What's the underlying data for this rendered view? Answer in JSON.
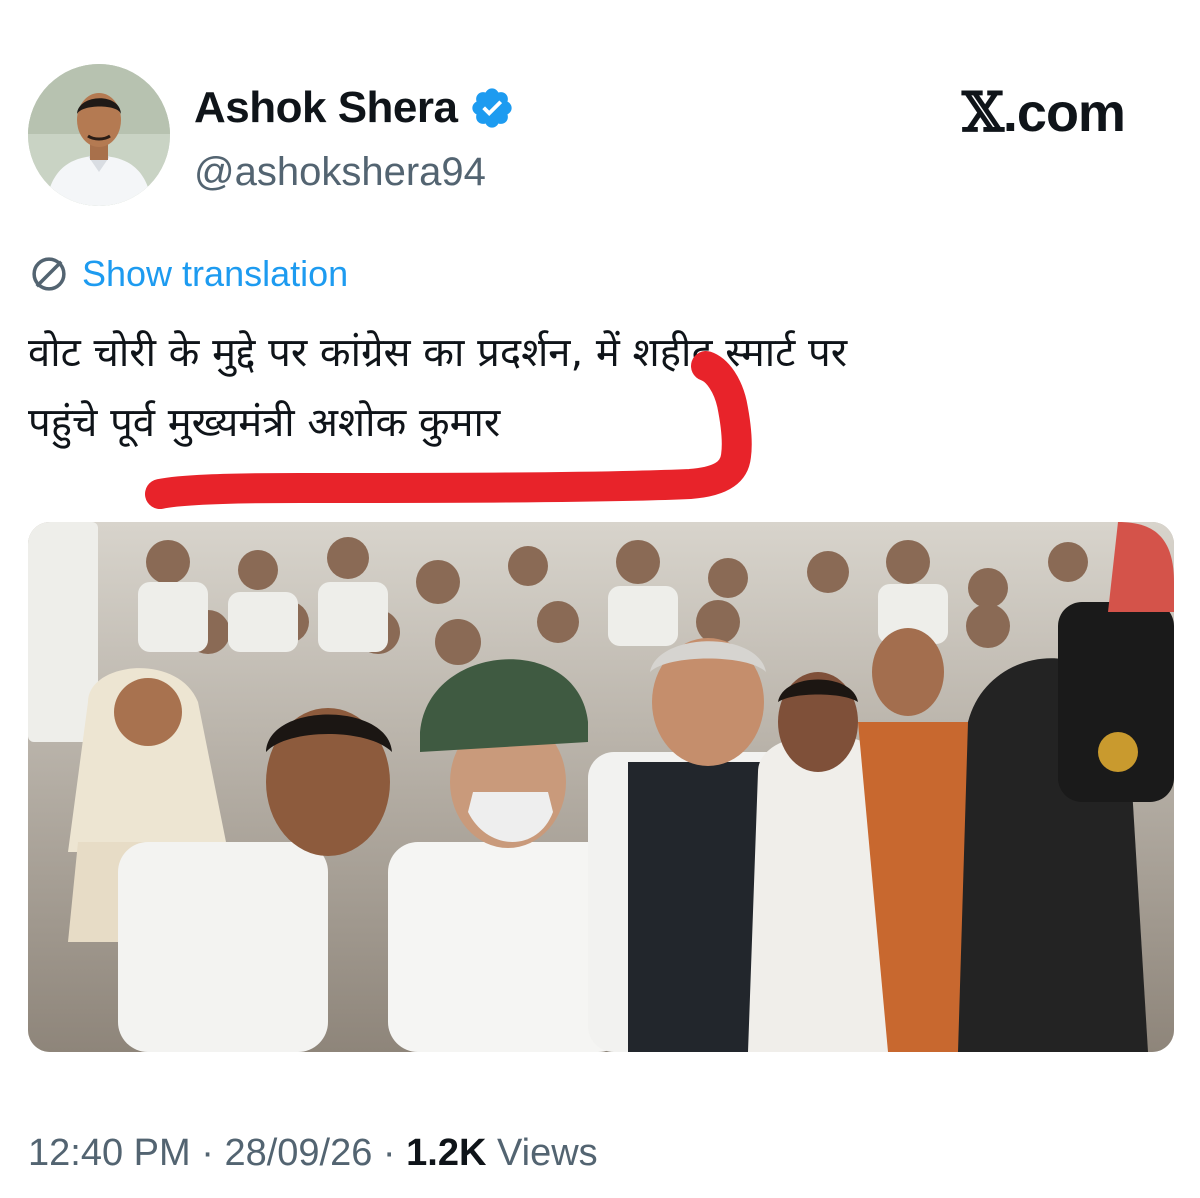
{
  "author": {
    "display_name": "Ashok Shera",
    "handle": "@ashokshera94",
    "verified": true
  },
  "site_badge": {
    "glyph": "𝕏",
    "suffix": ".com"
  },
  "translation": {
    "icon": "globe-icon",
    "link_label": "Show translation"
  },
  "tweet": {
    "line_1": "वोट चोरी के मुद्दे पर कांग्रेस का प्रदर्शन, में शहीद स्मार्ट पर",
    "line_2": "पहुंचे पूर्व मुख्यमंत्री अशोक कुमार"
  },
  "annotation": {
    "color": "#e8232a"
  },
  "meta": {
    "time": "12:40 PM",
    "separator": "·",
    "date": "28/09/26",
    "views_count": "1.2K",
    "views_label": "Views"
  },
  "colors": {
    "text": "#0f1419",
    "secondary": "#536471",
    "link": "#1d9bf0",
    "verified": "#1d9bf0"
  }
}
